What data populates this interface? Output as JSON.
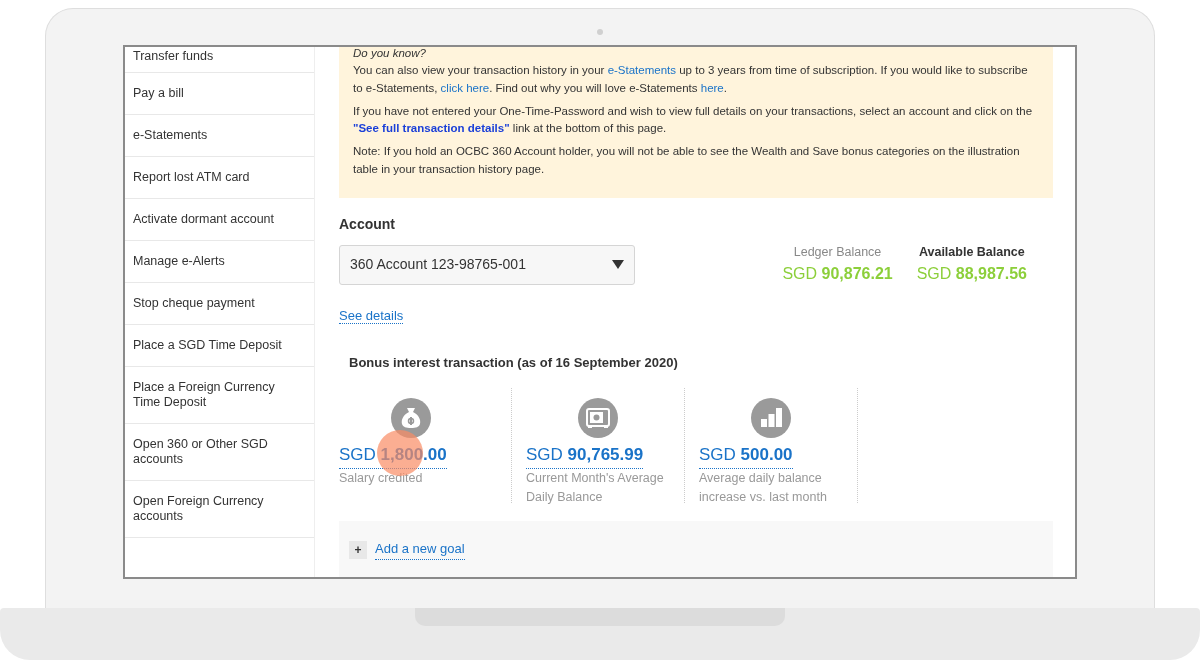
{
  "sidebar": {
    "items": [
      {
        "label": "Transfer funds"
      },
      {
        "label": "Pay a bill"
      },
      {
        "label": "e-Statements"
      },
      {
        "label": "Report lost ATM card"
      },
      {
        "label": "Activate dormant account"
      },
      {
        "label": "Manage e-Alerts"
      },
      {
        "label": "Stop cheque payment"
      },
      {
        "label": "Place a SGD Time Deposit"
      },
      {
        "label": "Place a Foreign Currency Time Deposit"
      },
      {
        "label": "Open 360 or Other SGD accounts"
      },
      {
        "label": "Open Foreign Currency accounts"
      }
    ]
  },
  "notice": {
    "title": "Do you know?",
    "paragraphs": [
      [
        {
          "kind": "text",
          "text": "You can also view your transaction history in your "
        },
        {
          "kind": "link",
          "text": "e-Statements"
        },
        {
          "kind": "text",
          "text": " up to 3 years from time of subscription. If you would like to subscribe to e-Statements, "
        },
        {
          "kind": "link",
          "text": "click here"
        },
        {
          "kind": "text",
          "text": ". Find out why you will love e-Statements "
        },
        {
          "kind": "link",
          "text": "here"
        },
        {
          "kind": "text",
          "text": "."
        }
      ],
      [
        {
          "kind": "text",
          "text": "If you have not entered your One-Time-Password and wish to view full details on your transactions, select an account and click on the "
        },
        {
          "kind": "bold-link",
          "text": "\"See full transaction details\""
        },
        {
          "kind": "text",
          "text": " link at the bottom of this page."
        }
      ],
      [
        {
          "kind": "text",
          "text": "Note: If you hold an OCBC 360 Account holder, you will not be able to see the Wealth and Save bonus categories on the illustration table in your transaction history page."
        }
      ]
    ]
  },
  "account": {
    "heading": "Account",
    "select_value": "360 Account 123-98765-001",
    "details_link": "See details"
  },
  "balances": [
    {
      "label": "Ledger Balance",
      "emphasis": false,
      "currency": "SGD",
      "amount": "90,876.21"
    },
    {
      "label": "Available Balance",
      "emphasis": true,
      "currency": "SGD",
      "amount": "88,987.56"
    }
  ],
  "bonus": {
    "title": "Bonus interest transaction (as of 16 September 2020)",
    "items": [
      {
        "kind": "bag",
        "currency": "SGD",
        "amount": "1,800.00",
        "caption": "Salary credited"
      },
      {
        "kind": "safe",
        "currency": "SGD",
        "amount": "90,765.99",
        "caption": "Current Month's Average Daily Balance"
      },
      {
        "kind": "chart",
        "currency": "SGD",
        "amount": "500.00",
        "caption": "Average daily balance increase vs. last month"
      }
    ]
  },
  "goal": {
    "button": "+",
    "link": "Add a new goal"
  }
}
